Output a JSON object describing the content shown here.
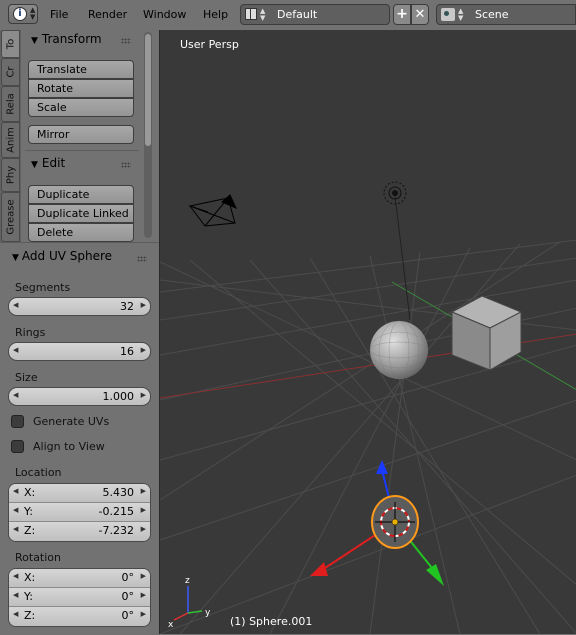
{
  "menubar": {
    "items": [
      "File",
      "Render",
      "Window",
      "Help"
    ],
    "layout": "Default",
    "scene": "Scene"
  },
  "tabs": [
    "To",
    "Cr",
    "Rela",
    "Anim",
    "Phy",
    "Grease"
  ],
  "tool_shelf": {
    "transform": {
      "title": "Transform",
      "buttons": [
        "Translate",
        "Rotate",
        "Scale"
      ],
      "mirror": "Mirror"
    },
    "edit": {
      "title": "Edit",
      "buttons": [
        "Duplicate",
        "Duplicate Linked",
        "Delete"
      ]
    }
  },
  "operator": {
    "title": "Add UV Sphere",
    "segments": {
      "label": "Segments",
      "value": "32"
    },
    "rings": {
      "label": "Rings",
      "value": "16"
    },
    "size": {
      "label": "Size",
      "value": "1.000"
    },
    "generate_uvs": "Generate UVs",
    "align_to_view": "Align to View",
    "location": {
      "label": "Location",
      "x": "5.430",
      "y": "-0.215",
      "z": "-7.232"
    },
    "rotation": {
      "label": "Rotation",
      "x": "0°",
      "y": "0°",
      "z": "0°"
    },
    "axis_labels": {
      "x": "X:",
      "y": "Y:",
      "z": "Z:"
    }
  },
  "viewport": {
    "view_label": "User Persp",
    "status": "(1) Sphere.001",
    "axis_x": "x",
    "axis_y": "y",
    "axis_z": "z"
  },
  "colors": {
    "panel": "#727272",
    "viewport": "#393939",
    "selected_outline": "#ff9a1a"
  }
}
